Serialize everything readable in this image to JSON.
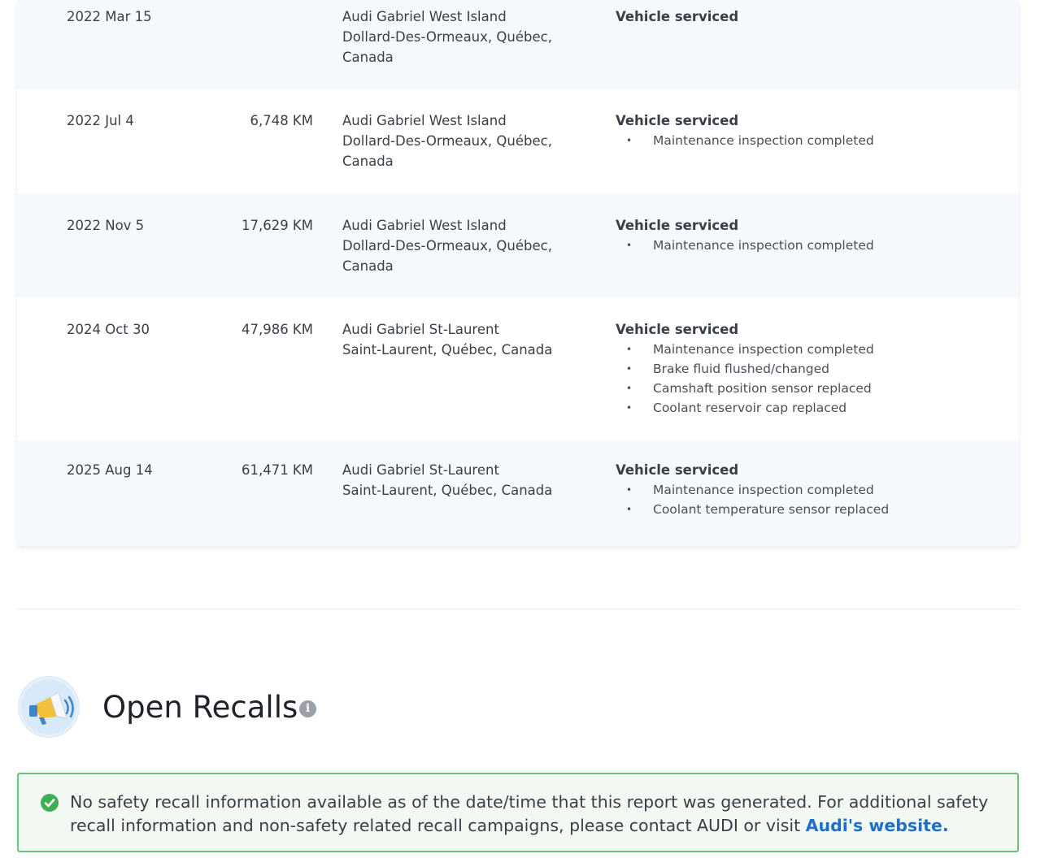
{
  "service_history": {
    "records": [
      {
        "date": "2022 Mar 15",
        "odometer": "",
        "dealer": "Audi Gabriel West Island",
        "location_lines": [
          "Dollard-Des-Ormeaux, Québec,",
          "Canada"
        ],
        "service_title": "Vehicle serviced",
        "items": []
      },
      {
        "date": "2022 Jul 4",
        "odometer": "6,748 KM",
        "dealer": "Audi Gabriel West Island",
        "location_lines": [
          "Dollard-Des-Ormeaux, Québec,",
          "Canada"
        ],
        "service_title": "Vehicle serviced",
        "items": [
          "Maintenance inspection completed"
        ]
      },
      {
        "date": "2022 Nov 5",
        "odometer": "17,629 KM",
        "dealer": "Audi Gabriel West Island",
        "location_lines": [
          "Dollard-Des-Ormeaux, Québec,",
          "Canada"
        ],
        "service_title": "Vehicle serviced",
        "items": [
          "Maintenance inspection completed"
        ]
      },
      {
        "date": "2024 Oct 30",
        "odometer": "47,986 KM",
        "dealer": "Audi Gabriel St-Laurent",
        "location_lines": [
          "Saint-Laurent, Québec, Canada"
        ],
        "service_title": "Vehicle serviced",
        "items": [
          "Maintenance inspection completed",
          "Brake fluid flushed/changed",
          "Camshaft position sensor replaced",
          "Coolant reservoir cap replaced"
        ]
      },
      {
        "date": "2025 Aug 14",
        "odometer": "61,471 KM",
        "dealer": "Audi Gabriel St-Laurent",
        "location_lines": [
          "Saint-Laurent, Québec, Canada"
        ],
        "service_title": "Vehicle serviced",
        "items": [
          "Maintenance inspection completed",
          "Coolant temperature sensor replaced"
        ]
      }
    ]
  },
  "open_recalls": {
    "title": "Open Recalls",
    "icon": "megaphone-icon",
    "info_glyph": "i",
    "notice_text": "No safety recall information available as of the date/time that this report was generated. For additional safety recall information and non-safety related recall campaigns, please contact AUDI or visit ",
    "link_text": "Audi's website."
  },
  "colors": {
    "alt_row_background": "#f6f9fc",
    "notice_border": "#6cc27a",
    "notice_background": "#f2f9f3",
    "check_green": "#3faf55",
    "link_blue": "#1f6fc6"
  }
}
